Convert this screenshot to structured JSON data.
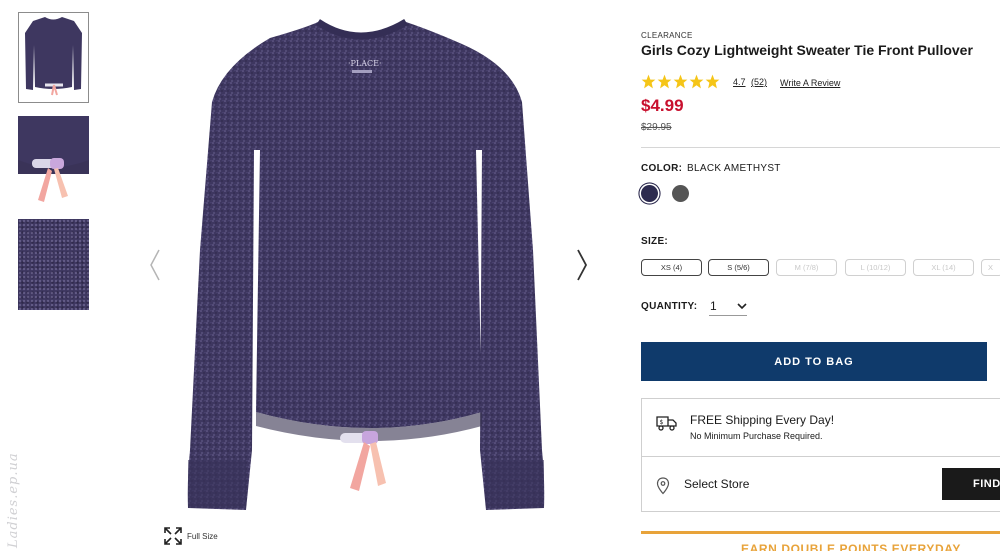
{
  "thumbnails": [
    {
      "alt": "sweater front"
    },
    {
      "alt": "tie detail"
    },
    {
      "alt": "fabric detail"
    }
  ],
  "main_image": {
    "garment_color": "#3e3760",
    "label_text": "PLACE"
  },
  "full_size_label": "Full Size",
  "watermark": "Ladies.ep.ua",
  "product": {
    "badge": "CLEARANCE",
    "title": "Girls Cozy Lightweight Sweater Tie Front Pullover",
    "rating_value": "4.7",
    "rating_stars": 4.7,
    "review_count": "(52)",
    "write_review": "Write A Review",
    "price": "$4.99",
    "was_price": "$29.95"
  },
  "color": {
    "label": "COLOR:",
    "value": "BLACK AMETHYST",
    "swatches": [
      {
        "name": "black amethyst",
        "hex": "#2d2b4f",
        "selected": true
      },
      {
        "name": "gray",
        "hex": "#555555",
        "selected": false
      }
    ]
  },
  "size": {
    "label": "SIZE:",
    "options": [
      {
        "label": "XS (4)",
        "available": true
      },
      {
        "label": "S (5/6)",
        "available": true
      },
      {
        "label": "M (7/8)",
        "available": false
      },
      {
        "label": "L (10/12)",
        "available": false
      },
      {
        "label": "XL (14)",
        "available": false
      },
      {
        "label": "X",
        "available": false
      }
    ]
  },
  "quantity": {
    "label": "QUANTITY:",
    "value": "1"
  },
  "add_to_bag": "ADD TO BAG",
  "shipping": {
    "title": "FREE Shipping Every Day!",
    "subtitle": "No Minimum Purchase Required."
  },
  "store": {
    "label": "Select Store",
    "find_button": "FIND"
  },
  "promo": {
    "text": "EARN DOUBLE POINTS EVERYDAY",
    "color": "#e8a33a"
  },
  "colors": {
    "brand_navy": "#0f3a6b",
    "price_red": "#c8102e",
    "star_gold": "#f5c518"
  }
}
